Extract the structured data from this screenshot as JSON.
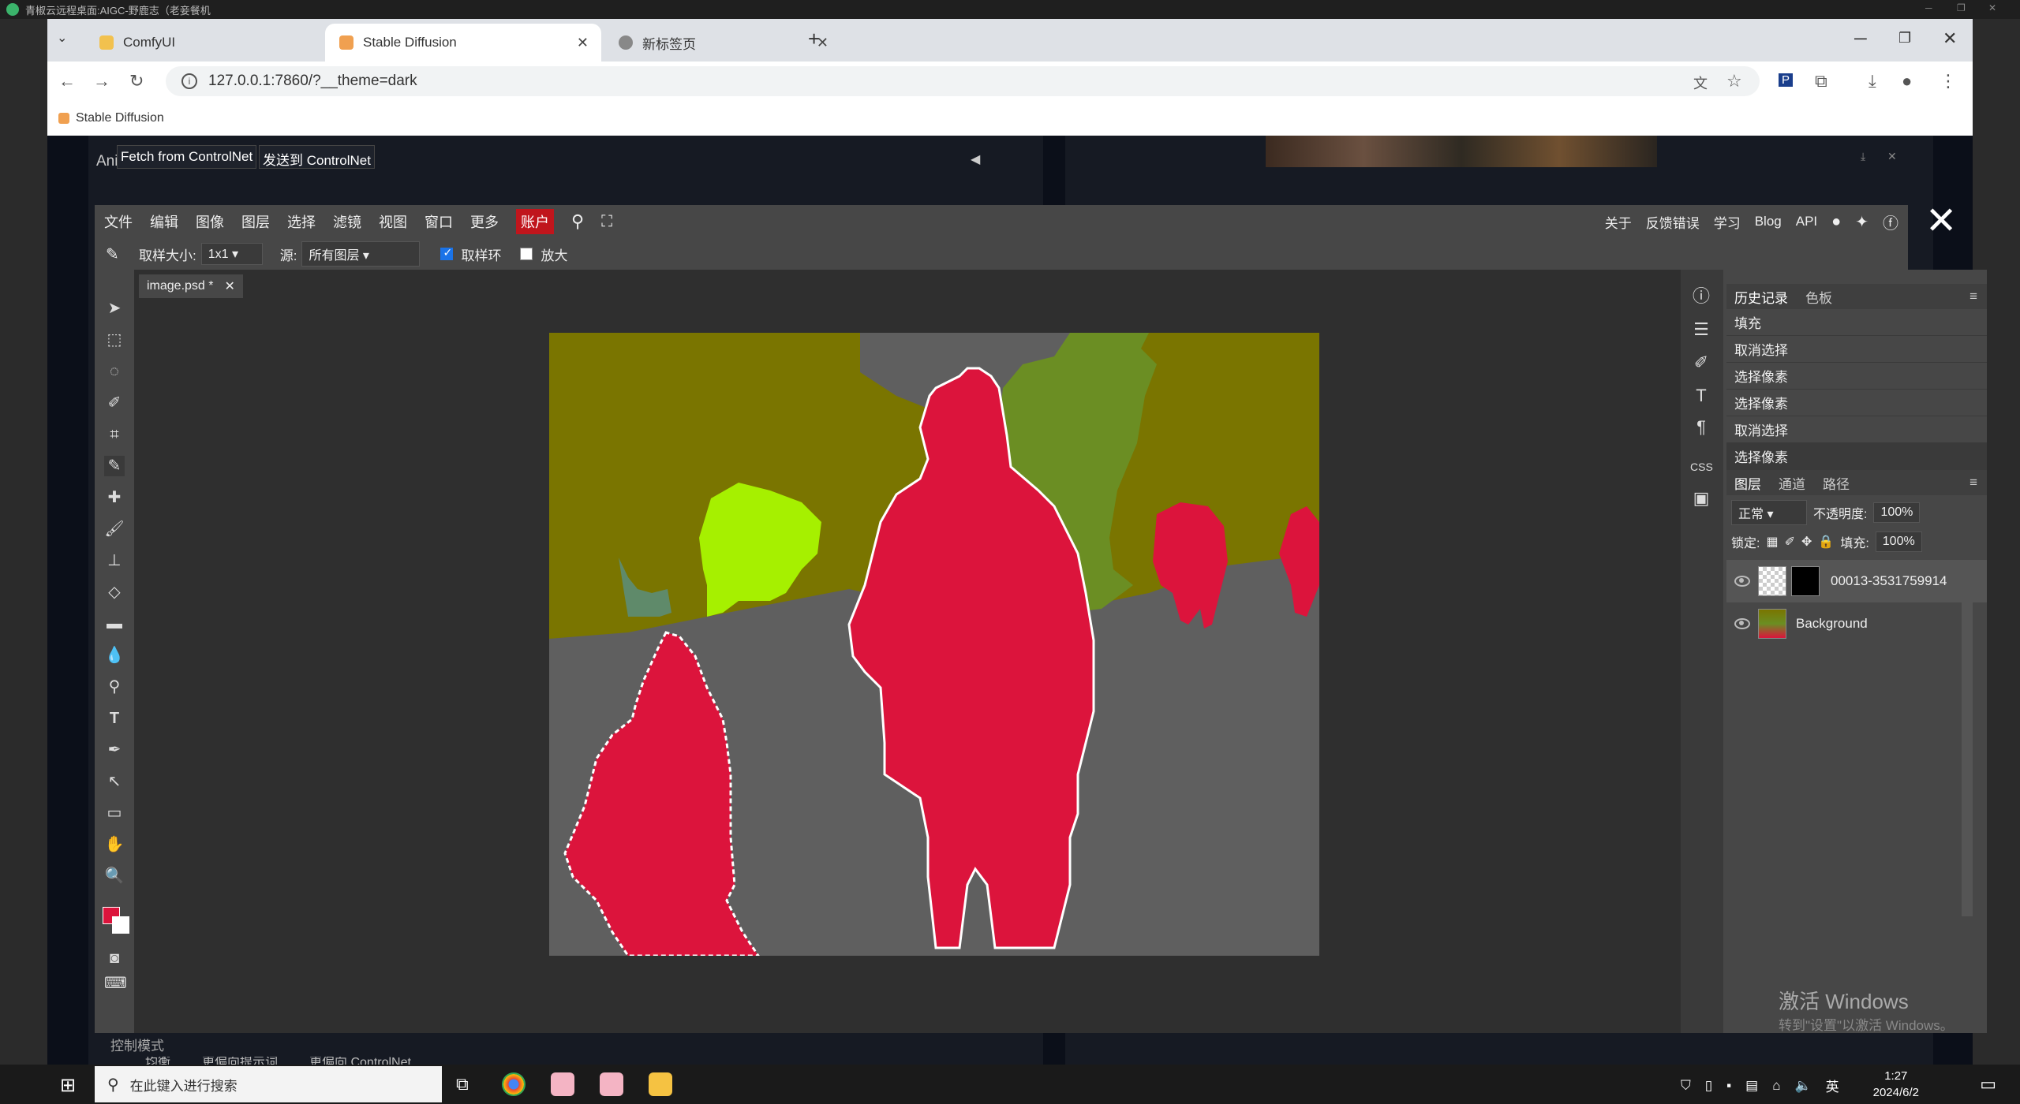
{
  "remote": {
    "title": "青椒云远程桌面:AIGC-野鹿志（老妾餐机"
  },
  "browser": {
    "tabs": [
      {
        "label": "ComfyUI"
      },
      {
        "label": "Stable Diffusion"
      },
      {
        "label": "新标签页"
      }
    ],
    "url": "127.0.0.1:7860/?__theme=dark",
    "bookmark": "Stable Diffusion"
  },
  "page": {
    "header_left": "Ani",
    "fetch_btn": "Fetch from ControlNet",
    "send_btn": "发送到 ControlNet",
    "control_mode": "控制模式",
    "mode_1": "均衡",
    "mode_2": "更偏向提示词",
    "mode_3": "更偏向 ControlNet"
  },
  "photopea": {
    "menu": [
      "文件",
      "编辑",
      "图像",
      "图层",
      "选择",
      "滤镜",
      "视图",
      "窗口",
      "更多"
    ],
    "account": "账户",
    "right_menu": [
      "关于",
      "反馈错误",
      "学习",
      "Blog",
      "API"
    ],
    "options": {
      "sample_size_label": "取样大小:",
      "sample_size_value": "1x1",
      "source_label": "源:",
      "source_value": "所有图层",
      "sample_ring": "取样环",
      "zoom": "放大"
    },
    "document_tab": "image.psd *",
    "history_tabs": [
      "历史记录",
      "色板"
    ],
    "history": [
      "填充",
      "取消选择",
      "选择像素",
      "选择像素",
      "取消选择",
      "选择像素"
    ],
    "layer_tabs": [
      "图层",
      "通道",
      "路径"
    ],
    "blend_mode": "正常",
    "opacity_label": "不透明度:",
    "opacity_value": "100%",
    "lock_label": "锁定:",
    "fill_label": "填充:",
    "fill_value": "100%",
    "layers": [
      {
        "name": "00013-3531759914"
      },
      {
        "name": "Background"
      }
    ],
    "watermark_1": "激活 Windows",
    "watermark_2": "转到\"设置\"以激活 Windows。"
  },
  "taskbar": {
    "search": "在此键入进行搜索",
    "time": "1:27",
    "date": "2024/6/2",
    "ime": "英"
  },
  "colors": {
    "fg_swatch": "#dc143c",
    "seg_olive": "#7a7500",
    "seg_gray": "#5f5f5f",
    "seg_person": "#dc143c",
    "seg_bear": "#a6f000",
    "seg_green": "#6b8e23"
  }
}
